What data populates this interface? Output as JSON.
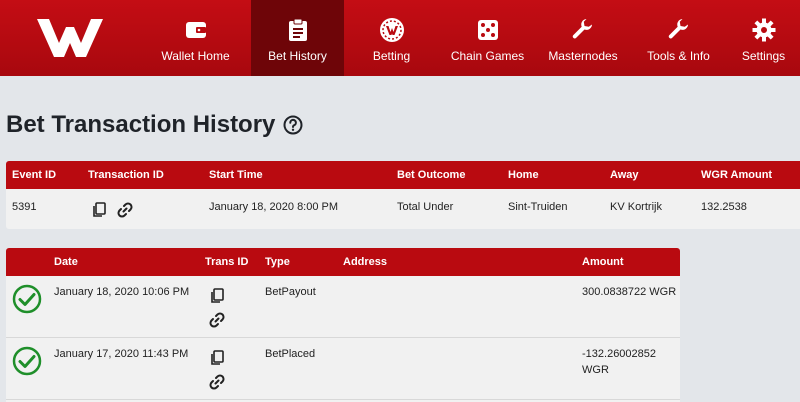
{
  "nav": {
    "items": [
      {
        "label": "Wallet Home",
        "icon": "wallet-icon"
      },
      {
        "label": "Bet History",
        "icon": "clipboard-icon"
      },
      {
        "label": "Betting",
        "icon": "wager-coin-icon"
      },
      {
        "label": "Chain Games",
        "icon": "dice-icon"
      },
      {
        "label": "Masternodes",
        "icon": "wrench-icon"
      },
      {
        "label": "Tools & Info",
        "icon": "wrench-icon"
      },
      {
        "label": "Settings",
        "icon": "gear-icon"
      }
    ],
    "active": "Bet History"
  },
  "page": {
    "title": "Bet Transaction History"
  },
  "event_table": {
    "headers": [
      "Event ID",
      "Transaction ID",
      "Start Time",
      "Bet Outcome",
      "Home",
      "Away",
      "WGR Amount"
    ],
    "row": {
      "event_id": "5391",
      "start_time": "January 18, 2020 8:00 PM",
      "bet_outcome": "Total Under",
      "home": "Sint-Truiden",
      "away": "KV Kortrijk",
      "amount": "132.2538"
    }
  },
  "tx_table": {
    "headers": [
      "Date",
      "Trans ID",
      "Type",
      "Address",
      "Amount"
    ],
    "rows": [
      {
        "date": "January 18, 2020 10:06 PM",
        "type": "BetPayout",
        "address": "",
        "amount_line1": "300.0838722 WGR",
        "amount_line2": ""
      },
      {
        "date": "January 17, 2020 11:43 PM",
        "type": "BetPlaced",
        "address": "",
        "amount_line1": "-132.26002852",
        "amount_line2": "WGR"
      }
    ]
  },
  "colors": {
    "brand_red": "#b90a10",
    "active_nav": "#6e0508",
    "success_green": "#1f8f2a"
  }
}
